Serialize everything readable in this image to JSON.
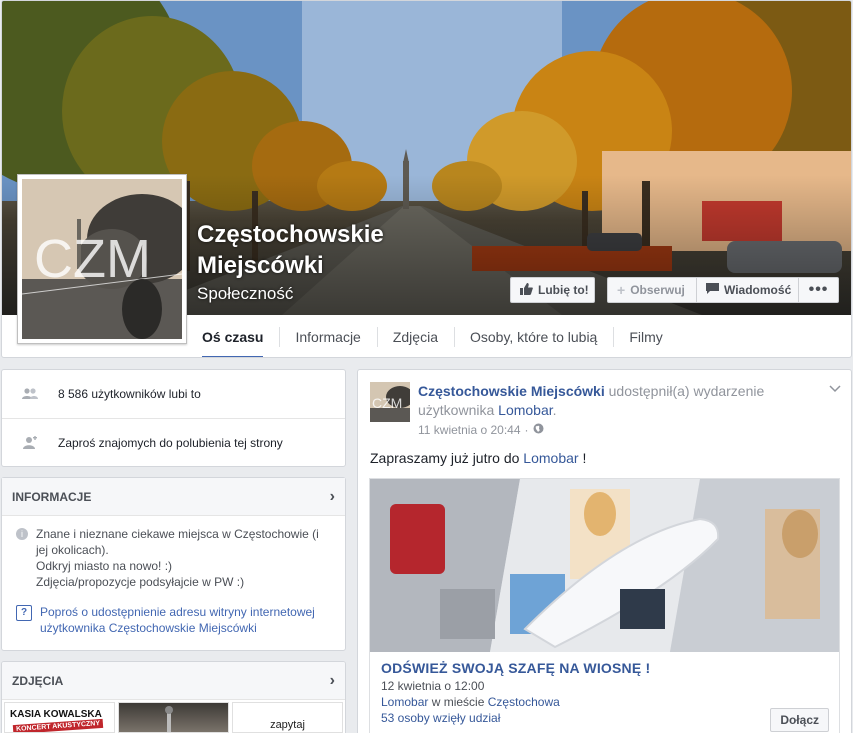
{
  "page": {
    "name": "Częstochowskie Miejscówki",
    "category": "Społeczność",
    "logo_text": "CZM"
  },
  "actions": {
    "like": "Lubię to!",
    "follow": "Obserwuj",
    "message": "Wiadomość",
    "more": "•••"
  },
  "tabs": [
    "Oś czasu",
    "Informacje",
    "Zdjęcia",
    "Osoby, które to lubią",
    "Filmy"
  ],
  "stats": {
    "likes": "8 586 użytkowników lubi to",
    "invite": "Zaproś znajomych do polubienia tej strony"
  },
  "info": {
    "title": "INFORMACJE",
    "description": "Znane i nieznane ciekawe miejsca w Częstochowie (i jej okolicach).",
    "line2": "Odkryj miasto na nowo! :)",
    "line3": "Zdjęcia/propozycje podsyłajcie w PW :)",
    "request_link": "Poproś o udostępnienie adresu witryny internetowej użytkownika Częstochowskie Miejscówki"
  },
  "photos": {
    "title": "ZDJĘCIA",
    "thumb1": "KASIA KOWALSKA",
    "thumb1_sub": "KONCERT AKUSTYCZNY",
    "thumb3": "zapytaj"
  },
  "post": {
    "author": "Częstochowskie Miejscówki",
    "action": "udostępnił(a) wydarzenie użytkownika",
    "target": "Lomobar",
    "date": "11 kwietnia o 20:44",
    "text_before": "Zapraszamy już jutro do",
    "text_link": "Lomobar",
    "text_after": "!",
    "event": {
      "title": "ODŚWIEŻ SWOJĄ SZAFĘ NA WIOSNĘ !",
      "when": "12 kwietnia o 12:00",
      "venue": "Lomobar",
      "venue_connector": "w mieście",
      "city": "Częstochowa",
      "going": "53 osoby wzięły udział",
      "join": "Dołącz"
    }
  },
  "colors": {
    "brand": "#4267b2",
    "link": "#365899",
    "background": "#e9ebee"
  }
}
